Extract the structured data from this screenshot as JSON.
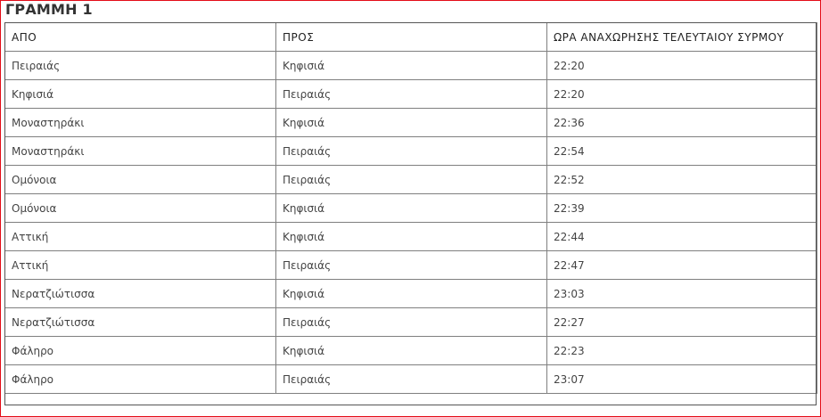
{
  "title": "ΓΡΑΜΜΗ 1",
  "table": {
    "headers": [
      "ΑΠΟ",
      "ΠΡΟΣ",
      "ΩΡΑ ΑΝΑΧΩΡΗΣΗΣ ΤΕΛΕΥΤΑΙΟΥ ΣΥΡΜΟΥ"
    ],
    "rows": [
      [
        "Πειραιάς",
        "Κηφισιά",
        "22:20"
      ],
      [
        "Κηφισιά",
        "Πειραιάς",
        "22:20"
      ],
      [
        "Μοναστηράκι",
        "Κηφισιά",
        "22:36"
      ],
      [
        "Μοναστηράκι",
        "Πειραιάς",
        "22:54"
      ],
      [
        "Ομόνοια",
        "Πειραιάς",
        "22:52"
      ],
      [
        "Ομόνοια",
        "Κηφισιά",
        "22:39"
      ],
      [
        "Αττική",
        "Κηφισιά",
        "22:44"
      ],
      [
        "Αττική",
        "Πειραιάς",
        "22:47"
      ],
      [
        "Νερατζιώτισσα",
        "Κηφισιά",
        "23:03"
      ],
      [
        "Νερατζιώτισσα",
        "Πειραιάς",
        "22:27"
      ],
      [
        "Φάληρο",
        "Κηφισιά",
        "22:23"
      ],
      [
        "Φάληρο",
        "Πειραιάς",
        "23:07"
      ]
    ]
  },
  "colors": {
    "frame_border": "#e30b17",
    "table_border": "#7f7f7f",
    "text": "#333333"
  }
}
